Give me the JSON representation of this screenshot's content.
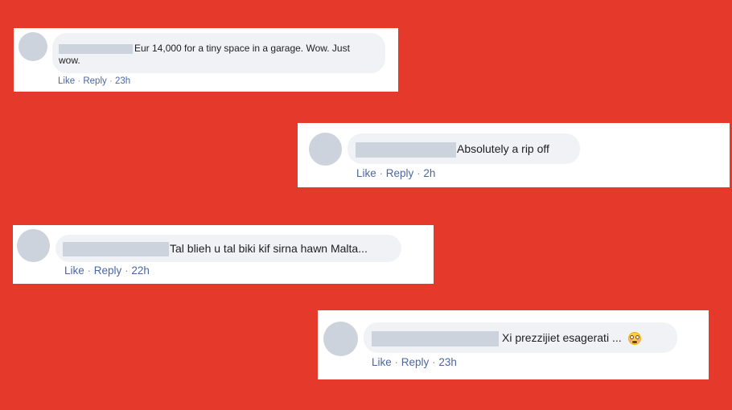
{
  "colors": {
    "background": "#e53a2b",
    "link": "#4b67a1",
    "bubble": "#f1f2f5",
    "avatar_placeholder": "#cdd3dc"
  },
  "comments": [
    {
      "text_line1": "Eur 14,000 for a tiny space in a garage. Wow. Just",
      "text_line2": "wow.",
      "like": "Like",
      "reply": "Reply",
      "time": "23h"
    },
    {
      "text": "Absolutely a rip off",
      "like": "Like",
      "reply": "Reply",
      "time": "2h"
    },
    {
      "text": "Tal blieh u tal biki kif sirna hawn Malta...",
      "like": "Like",
      "reply": "Reply",
      "time": "22h"
    },
    {
      "text": "Xi prezzijiet esagerati ...",
      "emoji": "flushed-face-icon",
      "like": "Like",
      "reply": "Reply",
      "time": "23h"
    }
  ],
  "separator": "·"
}
